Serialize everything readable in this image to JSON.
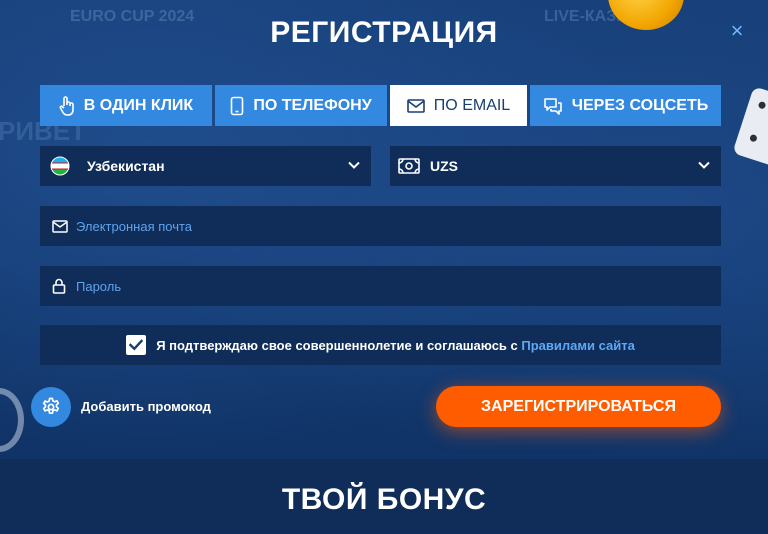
{
  "background": {
    "top_items": [
      "EURO CUP 2024",
      "LIVE-КАЗИНО"
    ],
    "side_items": [
      "РИВЕТ"
    ]
  },
  "modal": {
    "title": "РЕГИСТРАЦИЯ",
    "close_label": "×"
  },
  "tabs": [
    {
      "label": "В ОДИН КЛИК",
      "icon": "hand-pointer-icon",
      "active": false
    },
    {
      "label": "ПО ТЕЛЕФОНУ",
      "icon": "phone-icon",
      "active": false
    },
    {
      "label": "ПО EMAIL",
      "icon": "envelope-icon",
      "active": true
    },
    {
      "label": "ЧЕРЕЗ СОЦСЕТЬ",
      "icon": "chat-bubbles-icon",
      "active": false
    }
  ],
  "form": {
    "country": {
      "value": "Узбекистан",
      "icon": "uzbekistan-flag-icon"
    },
    "currency": {
      "value": "UZS",
      "icon": "money-bill-icon"
    },
    "email": {
      "value": "",
      "placeholder": "Электронная почта"
    },
    "password": {
      "value": "",
      "placeholder": "Пароль"
    },
    "agreement": {
      "checked": true,
      "text": "Я подтверждаю свое совершеннолетие и соглашаюсь с",
      "link": "Правилами сайта"
    },
    "promo_label": "Добавить промокод",
    "submit_label": "ЗАРЕГИСТРИРОВАТЬСЯ"
  },
  "bonus": {
    "title": "ТВОЙ БОНУС"
  },
  "colors": {
    "background": "#12386e",
    "field": "#0f2d58",
    "tab": "#3388e0",
    "accent": "#ff5c00",
    "link": "#5ea9f5"
  }
}
